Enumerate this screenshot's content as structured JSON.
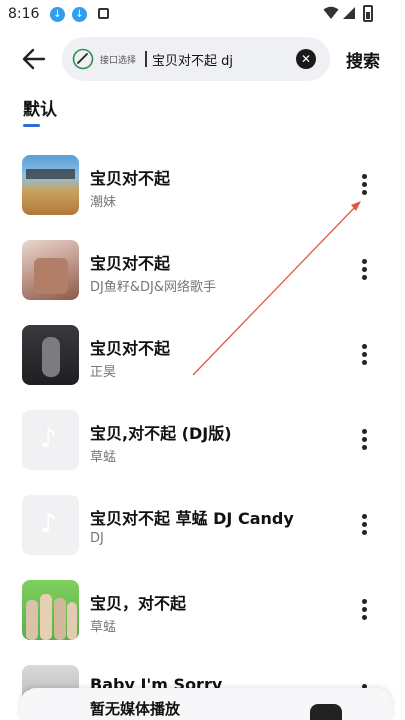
{
  "status": {
    "time": "8:16",
    "notifications": [
      "download-icon",
      "download-icon",
      "square-icon"
    ]
  },
  "header": {
    "source_label": "接口选择",
    "search_value": "宝贝对不起 dj",
    "search_button": "搜索"
  },
  "tabs": [
    {
      "label": "默认",
      "active": true
    }
  ],
  "songs": [
    {
      "title": "宝贝对不起",
      "artist": "潮妹",
      "cover": "album-art"
    },
    {
      "title": "宝贝对不起",
      "artist": "DJ鱼籽&DJ&网络歌手",
      "cover": "album-art"
    },
    {
      "title": "宝贝对不起",
      "artist": "正昊",
      "cover": "album-art"
    },
    {
      "title": "宝贝,对不起 (DJ版)",
      "artist": "草蜢",
      "cover": "placeholder"
    },
    {
      "title": "宝贝对不起 草蜢 DJ Candy",
      "artist": "DJ",
      "cover": "placeholder"
    },
    {
      "title": "宝贝，对不起",
      "artist": "草蜢",
      "cover": "album-art"
    },
    {
      "title": "Baby I'm Sorry",
      "artist": "",
      "cover": "album-art"
    }
  ],
  "player": {
    "text": "暂无媒体播放"
  },
  "colors": {
    "accent": "#2c6fd6",
    "annotation_arrow": "#e0574a"
  }
}
